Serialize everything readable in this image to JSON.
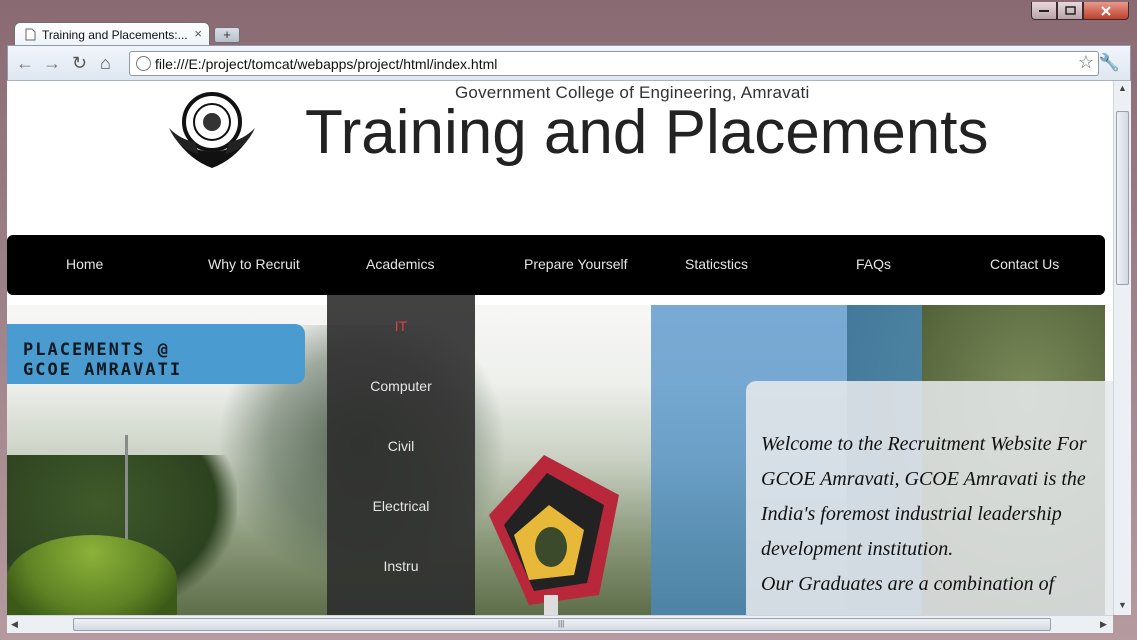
{
  "browser": {
    "tab_title": "Training and Placements:...",
    "tab_close": "×",
    "new_tab": "+",
    "url": "file:///E:/project/tomcat/webapps/project/html/index.html"
  },
  "header": {
    "college_name": "Government College of Engineering, Amravati",
    "site_title": "Training and Placements"
  },
  "nav": {
    "items": [
      "Home",
      "Why to Recruit",
      "Academics",
      "Prepare Yourself",
      "Staticstics",
      "FAQs",
      "Contact Us"
    ]
  },
  "academics_menu": {
    "items": [
      "IT",
      "Computer",
      "Civil",
      "Electrical",
      "Instru"
    ],
    "active": "IT"
  },
  "badge": {
    "line1": "PLACEMENTS @",
    "line2": "GCOE AMRAVATI"
  },
  "welcome": {
    "paragraph1": "Welcome to the Recruitment Website For GCOE Amravati, GCOE Amravati is the India's foremost industrial leadership development institution.",
    "paragraph2": " Our Graduates are a combination of"
  },
  "scrollbar": {
    "h_grip": "|||"
  },
  "colors": {
    "navbar": "#000000",
    "badge": "#4a9bd0",
    "active_menu": "#e04040"
  }
}
